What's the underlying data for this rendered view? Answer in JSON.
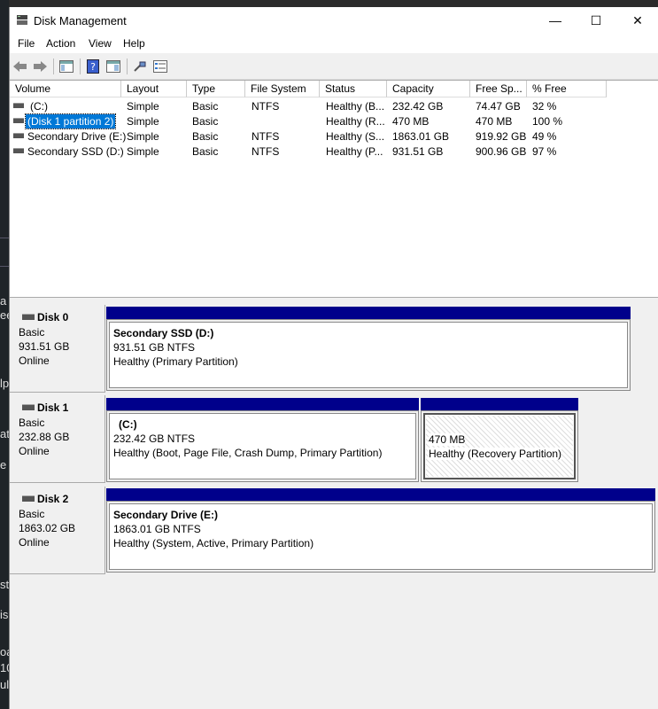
{
  "window": {
    "title": "Disk Management",
    "minimize": "—",
    "maximize": "☐",
    "close": "✕"
  },
  "menu": [
    "File",
    "Action",
    "View",
    "Help"
  ],
  "columns": [
    "Volume",
    "Layout",
    "Type",
    "File System",
    "Status",
    "Capacity",
    "Free Sp...",
    "% Free"
  ],
  "volumes": [
    {
      "volume": "(C:)",
      "layout": "Simple",
      "type": "Basic",
      "fs": "NTFS",
      "status": "Healthy (B...",
      "capacity": "232.42 GB",
      "free": "74.47 GB",
      "pct": "32 %"
    },
    {
      "volume": "(Disk 1 partition 2)",
      "layout": "Simple",
      "type": "Basic",
      "fs": "",
      "status": "Healthy (R...",
      "capacity": "470 MB",
      "free": "470 MB",
      "pct": "100 %"
    },
    {
      "volume": "Secondary Drive (E:)",
      "layout": "Simple",
      "type": "Basic",
      "fs": "NTFS",
      "status": "Healthy (S...",
      "capacity": "1863.01 GB",
      "free": "919.92 GB",
      "pct": "49 %"
    },
    {
      "volume": "Secondary SSD (D:)",
      "layout": "Simple",
      "type": "Basic",
      "fs": "NTFS",
      "status": "Healthy (P...",
      "capacity": "931.51 GB",
      "free": "900.96 GB",
      "pct": "97 %"
    }
  ],
  "disks": [
    {
      "name": "Disk 0",
      "type": "Basic",
      "size": "931.51 GB",
      "state": "Online",
      "parts": [
        {
          "title": "Secondary SSD  (D:)",
          "size": "931.51 GB NTFS",
          "status": "Healthy (Primary Partition)"
        }
      ]
    },
    {
      "name": "Disk 1",
      "type": "Basic",
      "size": "232.88 GB",
      "state": "Online",
      "parts": [
        {
          "title": "(C:)",
          "size": "232.42 GB NTFS",
          "status": "Healthy (Boot, Page File, Crash Dump, Primary Partition)"
        },
        {
          "title": "",
          "size": "470 MB",
          "status": "Healthy (Recovery Partition)"
        }
      ]
    },
    {
      "name": "Disk 2",
      "type": "Basic",
      "size": "1863.02 GB",
      "state": "Online",
      "parts": [
        {
          "title": "Secondary Drive  (E:)",
          "size": "1863.01 GB NTFS",
          "status": "Healthy (System, Active, Primary Partition)"
        }
      ]
    }
  ],
  "background_fragments": [
    "a",
    "ee",
    "lp",
    "at",
    "e",
    "st",
    "is",
    "oa",
    "10",
    "ul"
  ],
  "colors": {
    "partition_bar": "#00008b",
    "selection": "#0078d7"
  }
}
